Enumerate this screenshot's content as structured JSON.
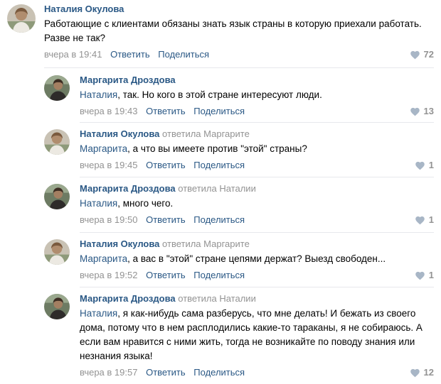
{
  "colors": {
    "link": "#2a5885",
    "muted": "#939393",
    "separator": "#e7e8ec",
    "heart": "#a8b6c6"
  },
  "icons": {
    "like": "heart-icon"
  },
  "comments": [
    {
      "author": "Наталия Окулова",
      "replied_to": "",
      "mention": "",
      "text": "Работающие с клиентами обязаны знать язык страны в которую приехали работать. Разве не так?",
      "date": "вчера в 19:41",
      "reply_label": "Ответить",
      "share_label": "Поделиться",
      "likes": "72"
    },
    {
      "author": "Маргарита Дроздова",
      "replied_to": "",
      "mention": "Наталия",
      "text": ", так. Но кого в этой стране интересуют люди.",
      "date": "вчера в 19:43",
      "reply_label": "Ответить",
      "share_label": "Поделиться",
      "likes": "13"
    },
    {
      "author": "Наталия Окулова",
      "replied_to": "ответила Маргарите",
      "mention": "Маргарита",
      "text": ", а что вы имеете против \"этой\" страны?",
      "date": "вчера в 19:45",
      "reply_label": "Ответить",
      "share_label": "Поделиться",
      "likes": "1"
    },
    {
      "author": "Маргарита Дроздова",
      "replied_to": "ответила Наталии",
      "mention": "Наталия",
      "text": ", много чего.",
      "date": "вчера в 19:50",
      "reply_label": "Ответить",
      "share_label": "Поделиться",
      "likes": "1"
    },
    {
      "author": "Наталия Окулова",
      "replied_to": "ответила Маргарите",
      "mention": "Маргарита",
      "text": ", а вас в \"этой\" стране цепями держат? Выезд свободен...",
      "date": "вчера в 19:52",
      "reply_label": "Ответить",
      "share_label": "Поделиться",
      "likes": "1"
    },
    {
      "author": "Маргарита Дроздова",
      "replied_to": "ответила Наталии",
      "mention": "Наталия",
      "text": ", я как-нибудь сама разберусь, что мне делать! И бежать из своего дома, потому что в нем расплодились какие-то тараканы, я не собираюсь. А если вам нравится с ними жить, тогда не возникайте по поводу знания или незнания языка!",
      "date": "вчера в 19:57",
      "reply_label": "Ответить",
      "share_label": "Поделиться",
      "likes": "12"
    }
  ]
}
